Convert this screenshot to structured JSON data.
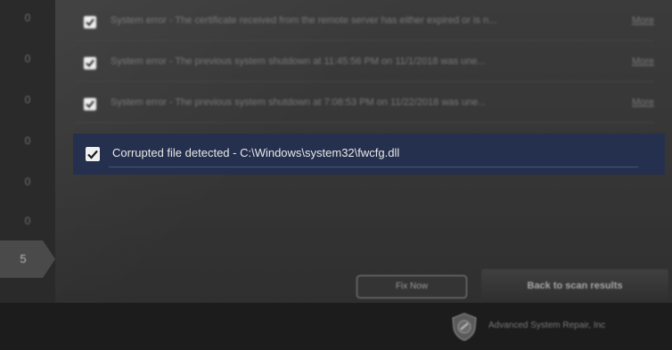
{
  "sidebar": {
    "counts": [
      "0",
      "0",
      "0",
      "0",
      "0",
      "0"
    ],
    "active_count": "5"
  },
  "results": [
    {
      "message": "System error - The certificate received from the remote server has either expired or is n...",
      "more": "More",
      "checked": true
    },
    {
      "message": "System error - The previous system shutdown at 11:45:56 PM on 11/1/2018 was une...",
      "more": "More",
      "checked": true
    },
    {
      "message": "System error - The previous system shutdown at 7:08:53 PM on 11/22/2018 was une...",
      "more": "More",
      "checked": true
    },
    {
      "message": "Corrupted file detected - C:\\Windows\\system32\\fwcfg.dll",
      "checked": true,
      "selected": true
    }
  ],
  "buttons": {
    "fix_now": "Fix Now",
    "back_to_scan": "Back to scan results"
  },
  "footer": {
    "company": "Advanced System Repair, Inc"
  },
  "colors": {
    "selected_row": "#25304e",
    "background": "#353535",
    "footer": "#1c1c1c"
  }
}
